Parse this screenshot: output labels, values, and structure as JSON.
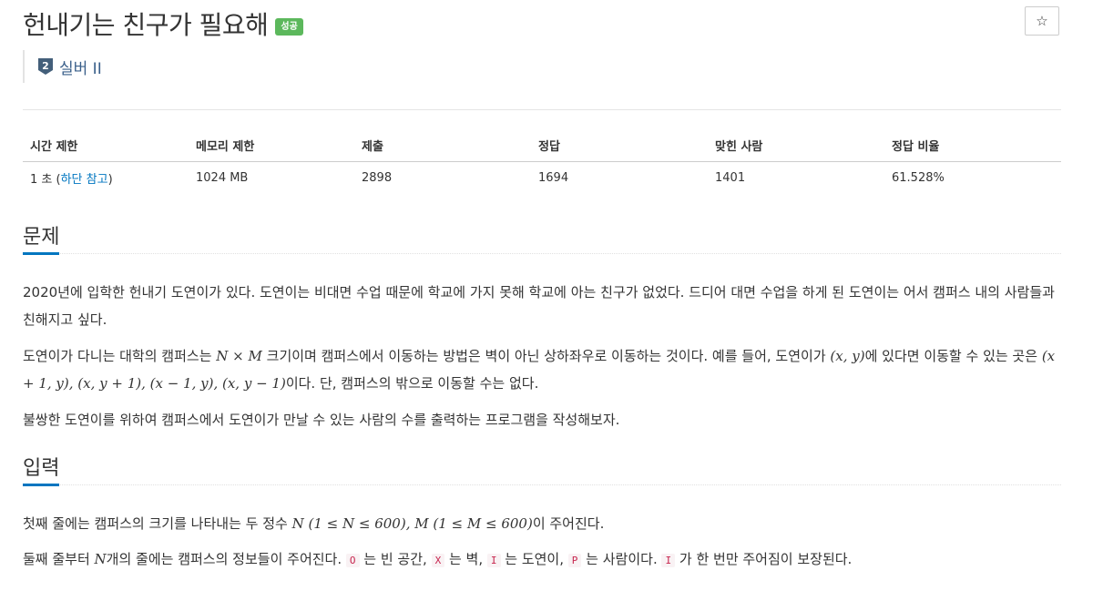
{
  "problem": {
    "title": "헌내기는 친구가 필요해",
    "status_badge": "성공",
    "star_icon": "☆",
    "tier": {
      "number": "2",
      "label": "실버 II"
    }
  },
  "stats": {
    "headers": [
      "시간 제한",
      "메모리 제한",
      "제출",
      "정답",
      "맞힌 사람",
      "정답 비율"
    ],
    "time_limit_value": "1 초 (",
    "time_limit_link": "하단 참고",
    "time_limit_close": ")",
    "memory_limit": "1024 MB",
    "submissions": "2898",
    "correct": "1694",
    "solved_users": "1401",
    "ratio": "61.528%"
  },
  "sections": {
    "problem_title": "문제",
    "input_title": "입력"
  },
  "problem_text": {
    "p1": "2020년에 입학한 헌내기 도연이가 있다. 도연이는 비대면 수업 때문에 학교에 가지 못해 학교에 아는 친구가 없었다. 드디어 대면 수업을 하게 된 도연이는 어서 캠퍼스 내의 사람들과 친해지고 싶다.",
    "p2_a": "도연이가 다니는 대학의 캠퍼스는 ",
    "p2_math1": "N × M",
    "p2_b": " 크기이며 캠퍼스에서 이동하는 방법은 벽이 아닌 상하좌우로 이동하는 것이다. 예를 들어, 도연이가 ",
    "p2_math2": "(x, y)",
    "p2_c": "에 있다면 이동할 수 있는 곳은 ",
    "p2_math3": "(x + 1, y), (x, y + 1), (x − 1, y), (x, y − 1)",
    "p2_d": "이다. 단, 캠퍼스의 밖으로 이동할 수는 없다.",
    "p3": "불쌍한 도연이를 위하여 캠퍼스에서 도연이가 만날 수 있는 사람의 수를 출력하는 프로그램을 작성해보자."
  },
  "input_text": {
    "l1_a": "첫째 줄에는 캠퍼스의 크기를 나타내는 두 정수 ",
    "l1_math": "N (1 ≤ N ≤ 600), M (1 ≤ M ≤ 600)",
    "l1_b": "이 주어진다.",
    "l2_a": "둘째 줄부터 ",
    "l2_math": "N",
    "l2_b": "개의 줄에는 캠퍼스의 정보들이 주어진다. ",
    "tok_o": "O",
    "l2_c": " 는 빈 공간, ",
    "tok_x": "X",
    "l2_d": " 는 벽, ",
    "tok_i": "I",
    "l2_e": " 는 도연이, ",
    "tok_p": "P",
    "l2_f": " 는 사람이다. ",
    "tok_i2": "I",
    "l2_g": " 가 한 번만 주어짐이 보장된다."
  },
  "colors": {
    "success_badge": "#5cb85c",
    "link": "#0076c0",
    "tier_icon": "#435f7a",
    "code_text": "#c7254e"
  }
}
